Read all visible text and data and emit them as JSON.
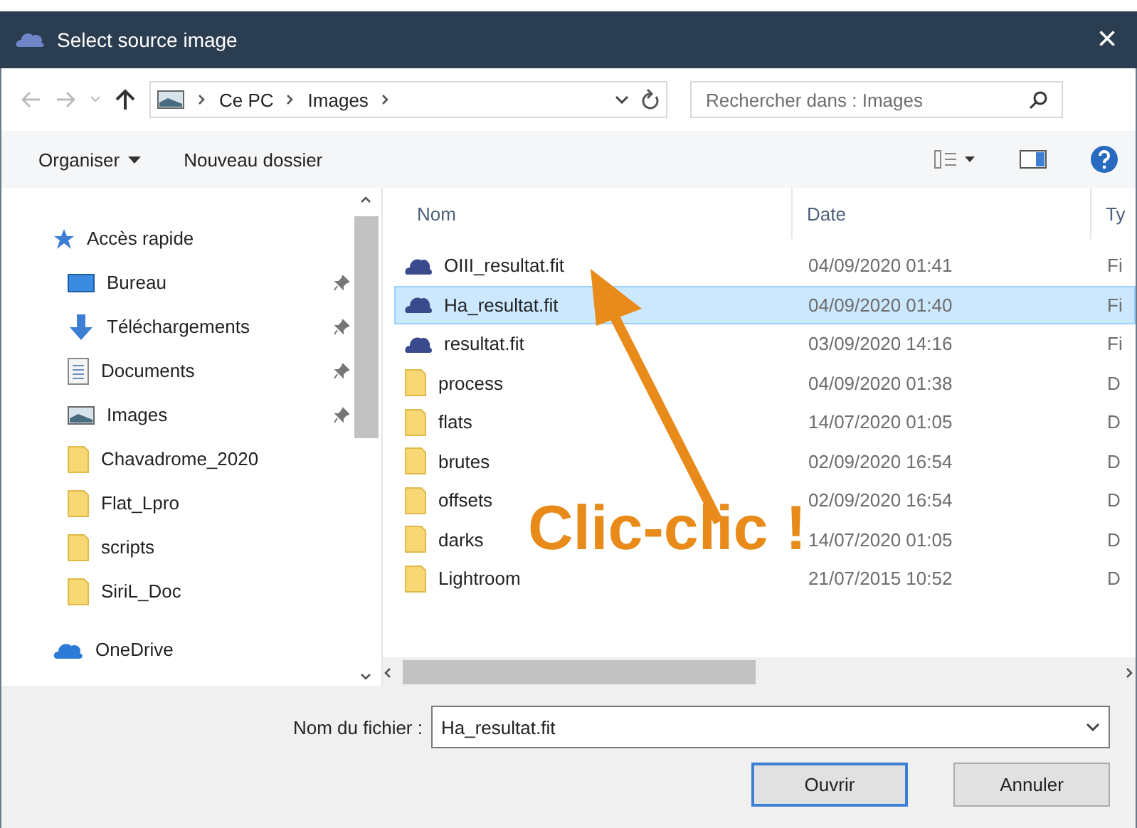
{
  "window": {
    "title": "Select source image",
    "close": "×"
  },
  "address_bar": {
    "path": [
      "Ce PC",
      "Images"
    ],
    "search_placeholder": "Rechercher dans : Images"
  },
  "toolbar": {
    "organize": "Organiser",
    "new_folder": "Nouveau dossier"
  },
  "sidebar": {
    "items": [
      {
        "label": "Accès rapide",
        "kind": "quick",
        "pinned": false,
        "children": [
          {
            "label": "Bureau",
            "kind": "desktop",
            "pinned": true
          },
          {
            "label": "Téléchargements",
            "kind": "download",
            "pinned": true
          },
          {
            "label": "Documents",
            "kind": "documents",
            "pinned": true
          },
          {
            "label": "Images",
            "kind": "images",
            "pinned": true
          },
          {
            "label": "Chavadrome_2020",
            "kind": "folder",
            "pinned": false
          },
          {
            "label": "Flat_Lpro",
            "kind": "folder",
            "pinned": false
          },
          {
            "label": "scripts",
            "kind": "folder",
            "pinned": false
          },
          {
            "label": "SiriL_Doc",
            "kind": "folder",
            "pinned": false
          }
        ]
      },
      {
        "label": "OneDrive",
        "kind": "cloud",
        "pinned": false
      }
    ]
  },
  "table": {
    "columns": [
      "Nom",
      "Date",
      "Ty"
    ],
    "rows": [
      {
        "name": "OIII_resultat.fit",
        "kind": "fits",
        "date": "04/09/2020 01:41",
        "column_3": "Fi",
        "selected": false
      },
      {
        "name": "Ha_resultat.fit",
        "kind": "fits",
        "date": "04/09/2020 01:40",
        "column_3": "Fi",
        "selected": true
      },
      {
        "name": "resultat.fit",
        "kind": "fits",
        "date": "03/09/2020 14:16",
        "column_3": "Fi",
        "selected": false
      },
      {
        "name": "process",
        "kind": "folder",
        "date": "04/09/2020 01:38",
        "column_3": "D",
        "selected": false
      },
      {
        "name": "flats",
        "kind": "folder",
        "date": "14/07/2020 01:05",
        "column_3": "D",
        "selected": false
      },
      {
        "name": "brutes",
        "kind": "folder",
        "date": "02/09/2020 16:54",
        "column_3": "D",
        "selected": false
      },
      {
        "name": "offsets",
        "kind": "folder",
        "date": "02/09/2020 16:54",
        "column_3": "D",
        "selected": false
      },
      {
        "name": "darks",
        "kind": "folder",
        "date": "14/07/2020 01:05",
        "column_3": "D",
        "selected": false
      },
      {
        "name": "Lightroom",
        "kind": "folder",
        "date": "21/07/2015 10:52",
        "column_3": "D",
        "selected": false
      }
    ]
  },
  "annotation": {
    "text": "Clic-clic !"
  },
  "footer": {
    "filename_label": "Nom du fichier :",
    "filename": "Ha_resultat.fit",
    "buttons": [
      {
        "label": "Ouvrir",
        "default": true
      },
      {
        "label": "Annuler",
        "default": false
      }
    ]
  }
}
